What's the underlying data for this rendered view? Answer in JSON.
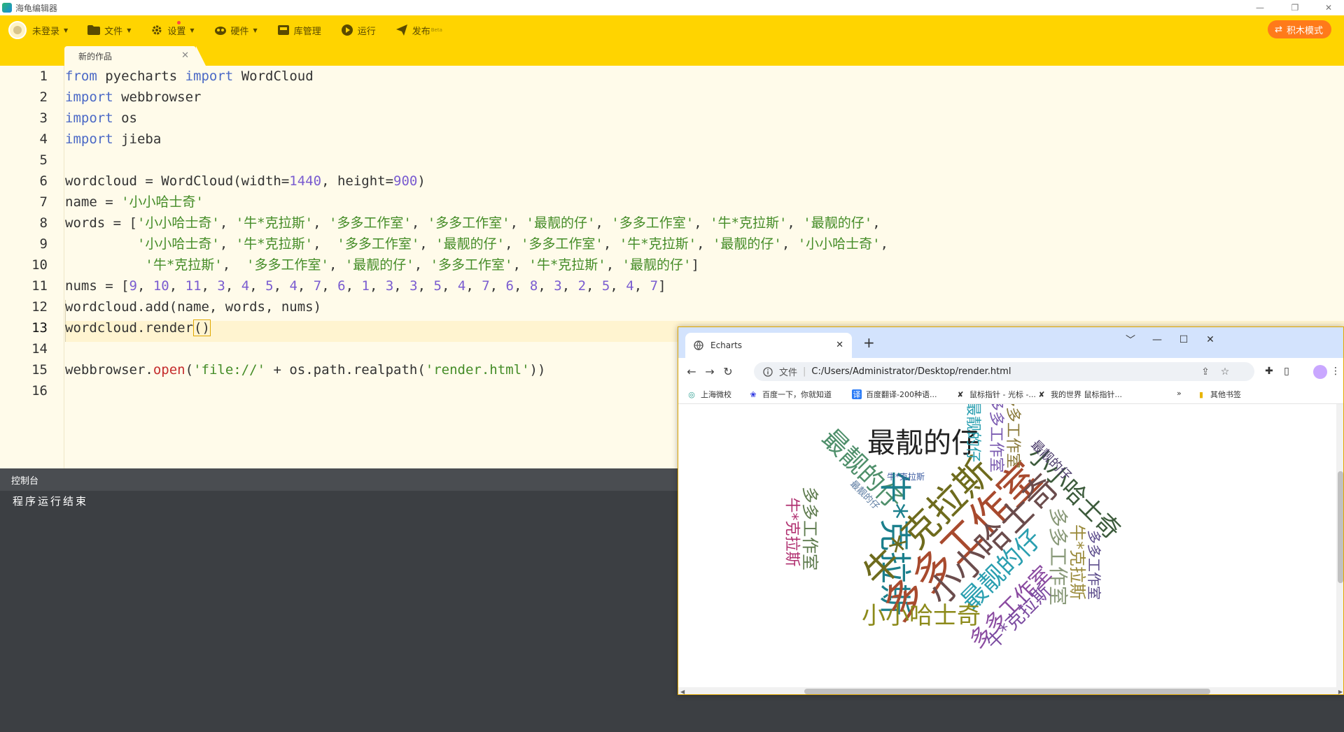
{
  "window": {
    "title": "海龟编辑器"
  },
  "toolbar": {
    "login": "未登录",
    "file": "文件",
    "settings": "设置",
    "hardware": "硬件",
    "library": "库管理",
    "run": "运行",
    "publish": "发布",
    "publish_badge": "Beta",
    "block_mode": "积木模式"
  },
  "tab": {
    "title": "新的作品"
  },
  "editor": {
    "line_numbers": [
      "1",
      "2",
      "3",
      "4",
      "5",
      "6",
      "7",
      "8",
      "9",
      "10",
      "11",
      "12",
      "13",
      "14",
      "15",
      "16"
    ],
    "active_line": 13
  },
  "console": {
    "title": "控制台",
    "output": "程序运行结束"
  },
  "browser": {
    "tab_title": "Echarts",
    "address_label": "文件",
    "url": "C:/Users/Administrator/Desktop/render.html",
    "bookmarks": [
      "上海微校",
      "百度一下，你就知道",
      "百度翻译-200种语...",
      "鼠标指针 - 光标 -...",
      "我的世界 鼠标指针..."
    ],
    "more_bookmarks": "»",
    "other_bookmarks": "其他书签"
  },
  "colors": {
    "toolbar_bg": "#ffd400",
    "editor_bg": "#fffbea",
    "console_bg": "#3c3f43",
    "block_mode_bg": "#ff7a1a"
  }
}
